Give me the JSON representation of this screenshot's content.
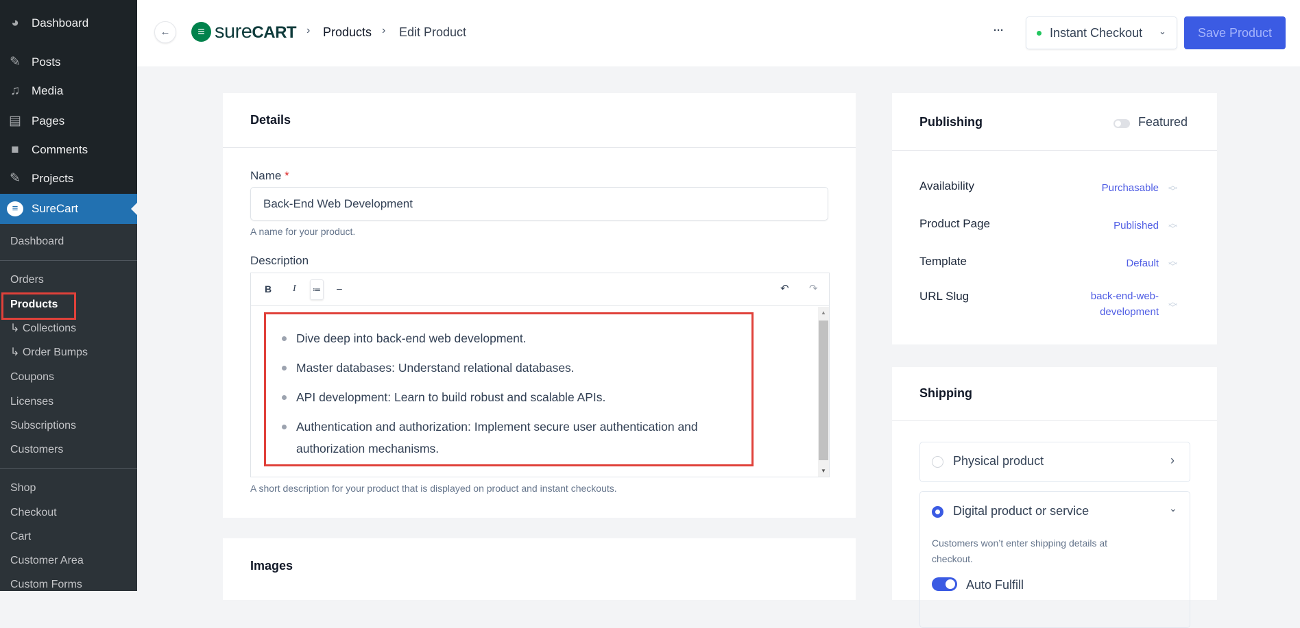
{
  "sidebar": {
    "top": [
      {
        "label": "Dashboard",
        "icon": "dashboard-icon"
      },
      {
        "label": "Posts",
        "icon": "pin-icon"
      },
      {
        "label": "Media",
        "icon": "media-icon"
      },
      {
        "label": "Pages",
        "icon": "pages-icon"
      },
      {
        "label": "Comments",
        "icon": "comment-icon"
      },
      {
        "label": "Projects",
        "icon": "pin-icon"
      }
    ],
    "surecart": "SureCart",
    "sub": [
      "Dashboard",
      "Orders",
      "Products",
      "↳ Collections",
      "↳ Order Bumps",
      "Coupons",
      "Licenses",
      "Subscriptions",
      "Customers",
      "Shop",
      "Checkout",
      "Cart",
      "Customer Area",
      "Custom Forms"
    ]
  },
  "header": {
    "logo_light": "sure",
    "logo_bold": "CART",
    "breadcrumb": [
      "Products",
      "Edit Product"
    ],
    "more": "···",
    "checkout_select": "Instant Checkout",
    "save": "Save Product",
    "colors": {
      "accent": "#3b5be3",
      "green": "#22c55e"
    }
  },
  "details": {
    "title": "Details",
    "name_label": "Name",
    "required": "*",
    "name_value": "Back-End Web Development",
    "name_help": "A name for your product.",
    "desc_label": "Description",
    "toolbar": {
      "bold": "B",
      "italic": "I",
      "list": "≔",
      "hr": "–",
      "undo": "↶",
      "redo": "↷"
    },
    "bullets": [
      "Dive deep into back-end web development.",
      "Master databases: Understand relational databases.",
      "API development: Learn to build robust and scalable APIs.",
      "Authentication and authorization: Implement secure user authentication and authorization mechanisms."
    ],
    "desc_help": "A short description for your product that is displayed on product and instant checkouts."
  },
  "images": {
    "title": "Images"
  },
  "publishing": {
    "title": "Publishing",
    "featured": "Featured",
    "rows": [
      {
        "label": "Availability",
        "value": "Purchasable"
      },
      {
        "label": "Product Page",
        "value": "Published"
      },
      {
        "label": "Template",
        "value": "Default"
      },
      {
        "label": "URL Slug",
        "value": "back-end-web-development"
      }
    ]
  },
  "shipping": {
    "title": "Shipping",
    "physical": "Physical product",
    "digital": "Digital product or service",
    "digital_help": "Customers won’t enter shipping details at checkout.",
    "auto_fulfill": "Auto Fulfill"
  }
}
